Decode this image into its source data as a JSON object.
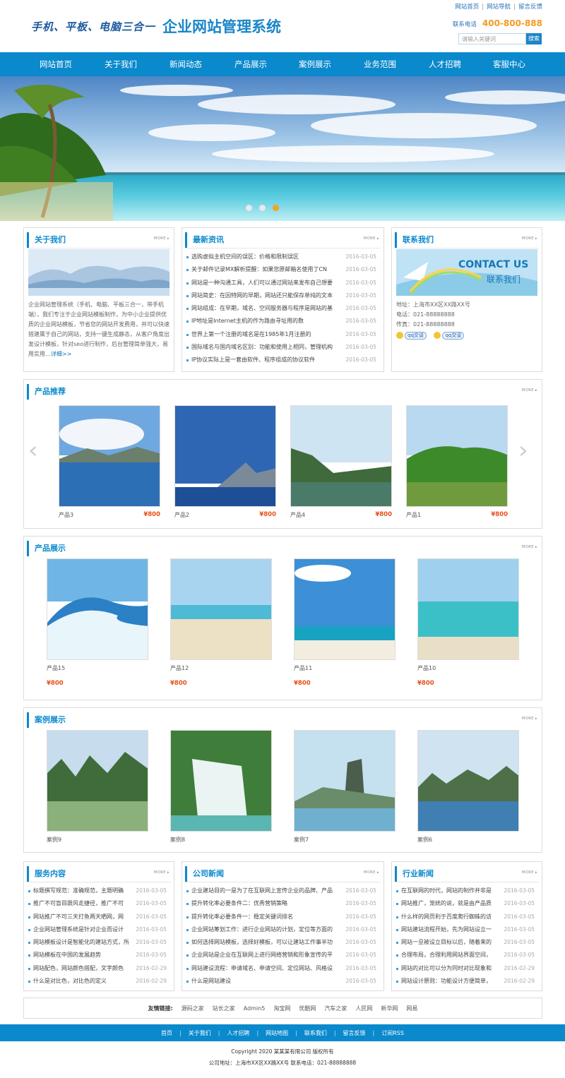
{
  "header": {
    "top_links": [
      "网站首页",
      "网站导航",
      "留言反馈"
    ],
    "slogan": "手机、平板、电脑三合一",
    "site_name": "企业网站管理系统",
    "phone_label": "联系电话",
    "phone": "400-800-888",
    "search_placeholder": "请输入关键词",
    "search_button": "搜索"
  },
  "nav": [
    "网站首页",
    "关于我们",
    "新闻动态",
    "产品展示",
    "案例展示",
    "业务范围",
    "人才招聘",
    "客服中心"
  ],
  "banner": {
    "slides": 3,
    "active": 3
  },
  "about": {
    "title": "关于我们",
    "more": "MORE ▸",
    "text": "企业网站管理系统（手机、电脑、平板三合一，带手机端），我们专注于企业网站模板制作，为中小企业提供优质的企业网站模板，节省您的网站开发费用，并可以快速搭建属于自己的网站，支持一键生成静态，从客户角度出发设计模板，针对seo进行制作，后台管理简单强大，易用实用…",
    "detail": "详细>>"
  },
  "news": {
    "title": "最新资讯",
    "more": "MORE ▸",
    "items": [
      {
        "t": "选购虚拟主机空间的误区：价格和限制误区",
        "d": "2016-03-05"
      },
      {
        "t": "关于邮件记录MX解析提醒：如果您原邮箱名使用了CN",
        "d": "2016-03-05"
      },
      {
        "t": "网站是一种沟通工具，人们可以通过网站来发布自己想要",
        "d": "2016-03-05"
      },
      {
        "t": "网站简史：在因特网的早期，网站还只能保存单纯的文本",
        "d": "2016-03-05"
      },
      {
        "t": "网站组成：在早期，域名、空间服务器与程序是网站的基",
        "d": "2016-03-05"
      },
      {
        "t": "IP地址是Internet主机的作为路由寻址用的数",
        "d": "2016-03-05"
      },
      {
        "t": "世界上第一个注册的域名是在1985年1月注册的",
        "d": "2016-03-05"
      },
      {
        "t": "国际域名与国内域名区别：功能和使用上相同，管理机构",
        "d": "2016-03-05"
      },
      {
        "t": "IP协议实际上是一套由软件、程序组成的协议软件",
        "d": "2016-03-05"
      }
    ]
  },
  "contact": {
    "title": "联系我们",
    "more": "MORE ▸",
    "image_title": "CONTACT US",
    "image_sub": "联系我们",
    "address": "地址：上海市XX区XX路XX号",
    "tel": "电话：021-88888888",
    "fax": "传真：021-88888888",
    "qq": [
      "qq交谈",
      "qq交谈"
    ]
  },
  "recommend": {
    "title": "产品推荐",
    "more": "MORE ▸",
    "items": [
      {
        "name": "产品3",
        "price": "¥800"
      },
      {
        "name": "产品2",
        "price": "¥800"
      },
      {
        "name": "产品4",
        "price": "¥800"
      },
      {
        "name": "产品1",
        "price": "¥800"
      }
    ]
  },
  "products": {
    "title": "产品展示",
    "more": "MORE ▸",
    "items": [
      {
        "name": "产品15",
        "price": "¥800"
      },
      {
        "name": "产品12",
        "price": "¥800"
      },
      {
        "name": "产品11",
        "price": "¥800"
      },
      {
        "name": "产品10",
        "price": "¥800"
      }
    ]
  },
  "cases": {
    "title": "案例展示",
    "more": "MORE ▸",
    "items": [
      {
        "name": "案例9"
      },
      {
        "name": "案例8"
      },
      {
        "name": "案例7"
      },
      {
        "name": "案例6"
      }
    ]
  },
  "service": {
    "title": "服务内容",
    "more": "MORE ▸",
    "items": [
      {
        "t": "标题撰写规范：准确规范，主题明确",
        "d": "2016-03-05"
      },
      {
        "t": "推广不可盲目跟风走捷径，推广不可",
        "d": "2016-03-05"
      },
      {
        "t": "网站推广不可三天打鱼两天晒网，网",
        "d": "2016-03-05"
      },
      {
        "t": "企业网站管理系统是针对企业而设计",
        "d": "2016-03-05"
      },
      {
        "t": "网站模板设计是智能化的建站方式，所",
        "d": "2016-03-05"
      },
      {
        "t": "网站模板在中国的发展趋势",
        "d": "2016-03-05"
      },
      {
        "t": "网站配色，网站颜色搭配，文字颜色",
        "d": "2016-02-29"
      },
      {
        "t": "什么是对比色，对比色的定义",
        "d": "2016-02-29"
      }
    ]
  },
  "company": {
    "title": "公司新闻",
    "more": "MORE ▸",
    "items": [
      {
        "t": "企业建站目的一是为了在互联网上宣传企业的品牌、产品",
        "d": "2016-03-05"
      },
      {
        "t": "提升转化率必要条件二：优秀营销策略",
        "d": "2016-03-05"
      },
      {
        "t": "提升转化率必要条件一：稳定关键词排名",
        "d": "2016-03-05"
      },
      {
        "t": "企业网站筹划工作：进行企业网站的计划，定位等方面的",
        "d": "2016-03-05"
      },
      {
        "t": "如何选择网站模板，选择好模板，可以让建站工作事半功",
        "d": "2016-03-05"
      },
      {
        "t": "企业网站是企业在互联网上进行网络营销和形象宣传的平",
        "d": "2016-03-05"
      },
      {
        "t": "网站建设流程：申请域名、申请空间、定位网站、风格设",
        "d": "2016-03-05"
      },
      {
        "t": "什么是网站建设",
        "d": "2016-03-05"
      }
    ]
  },
  "industry": {
    "title": "行业新闻",
    "more": "MORE ▸",
    "items": [
      {
        "t": "在互联网的时代，网站的制作并非是",
        "d": "2016-03-05"
      },
      {
        "t": "网站推广，笼统的说，就是由产品质",
        "d": "2016-03-05"
      },
      {
        "t": "什么样的网页利于百度爬行蜘蛛的访",
        "d": "2016-03-05"
      },
      {
        "t": "网站建站流程开始，先为网站设立一",
        "d": "2016-03-05"
      },
      {
        "t": "网站一旦被设立目标以后，随着来的",
        "d": "2016-03-05"
      },
      {
        "t": "合理布局，合理利用网站界面空间，",
        "d": "2016-03-05"
      },
      {
        "t": "网站的对比可以分为同时对比现象和",
        "d": "2016-02-29"
      },
      {
        "t": "网站设计原则：功能设计方便简单，",
        "d": "2016-02-29"
      }
    ]
  },
  "friends": {
    "label": "友情链接:",
    "links": [
      "源码之家",
      "站长之家",
      "Admin5",
      "淘宝网",
      "优酷网",
      "汽车之家",
      "人民网",
      "新华网",
      "网易"
    ]
  },
  "footer": {
    "links": [
      "首页",
      "关于我们",
      "人才招聘",
      "网站地图",
      "联系我们",
      "留言反馈",
      "订阅RSS"
    ],
    "copyright": "Copyright 2020 某某某有限公司 版权所有",
    "address": "公司地址：上海市XX区XX路XX号 联系电话：021-88888888"
  }
}
